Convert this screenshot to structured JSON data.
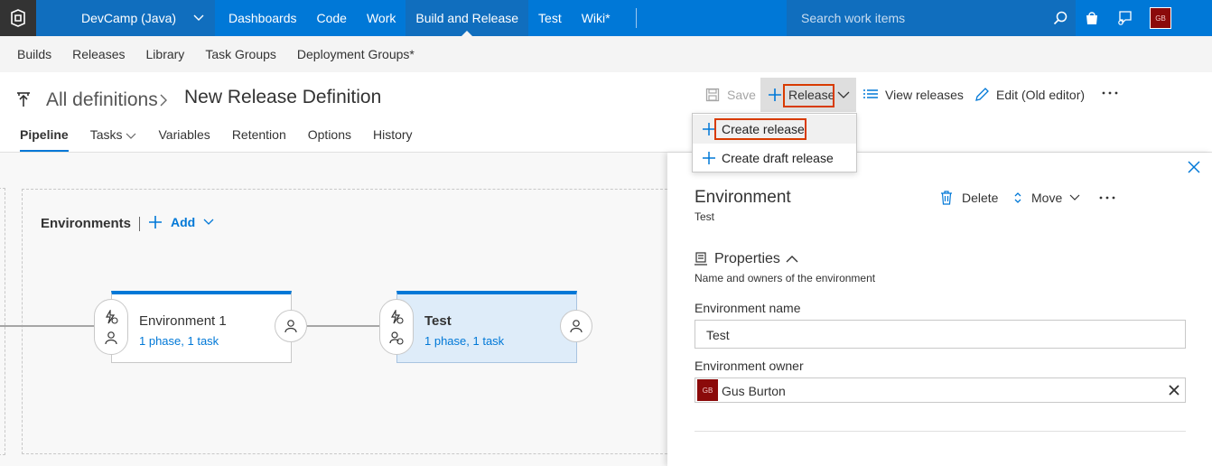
{
  "topnav": {
    "project": "DevCamp (Java)",
    "items": [
      "Dashboards",
      "Code",
      "Work",
      "Build and Release",
      "Test",
      "Wiki*"
    ],
    "active_index": 3,
    "search_placeholder": "Search work items",
    "user_initials": "GB"
  },
  "subnav": {
    "items": [
      "Builds",
      "Releases",
      "Library",
      "Task Groups",
      "Deployment Groups*"
    ]
  },
  "header": {
    "breadcrumb_root": "All definitions",
    "title": "New Release Definition"
  },
  "toolbar": {
    "save": "Save",
    "release": "Release",
    "view_releases": "View releases",
    "edit_old": "Edit (Old editor)"
  },
  "release_menu": {
    "items": [
      "Create release",
      "Create draft release"
    ]
  },
  "tabs": {
    "items": [
      "Pipeline",
      "Tasks",
      "Variables",
      "Retention",
      "Options",
      "History"
    ],
    "selected": "Pipeline"
  },
  "pipeline": {
    "section_title": "Environments",
    "add_label": "Add",
    "environments": [
      {
        "name": "Environment 1",
        "summary": "1 phase, 1 task",
        "selected": false
      },
      {
        "name": "Test",
        "summary": "1 phase, 1 task",
        "selected": true
      }
    ]
  },
  "panel": {
    "title": "Environment",
    "subtitle": "Test",
    "delete": "Delete",
    "move": "Move",
    "section": "Properties",
    "section_desc": "Name and owners of the environment",
    "name_label": "Environment name",
    "name_value": "Test",
    "owner_label": "Environment owner",
    "owner_value": "Gus Burton",
    "owner_initials": "GB"
  },
  "colors": {
    "brand": "#0078d7",
    "highlight": "#d83b01",
    "avatar": "#8b0a0a"
  }
}
